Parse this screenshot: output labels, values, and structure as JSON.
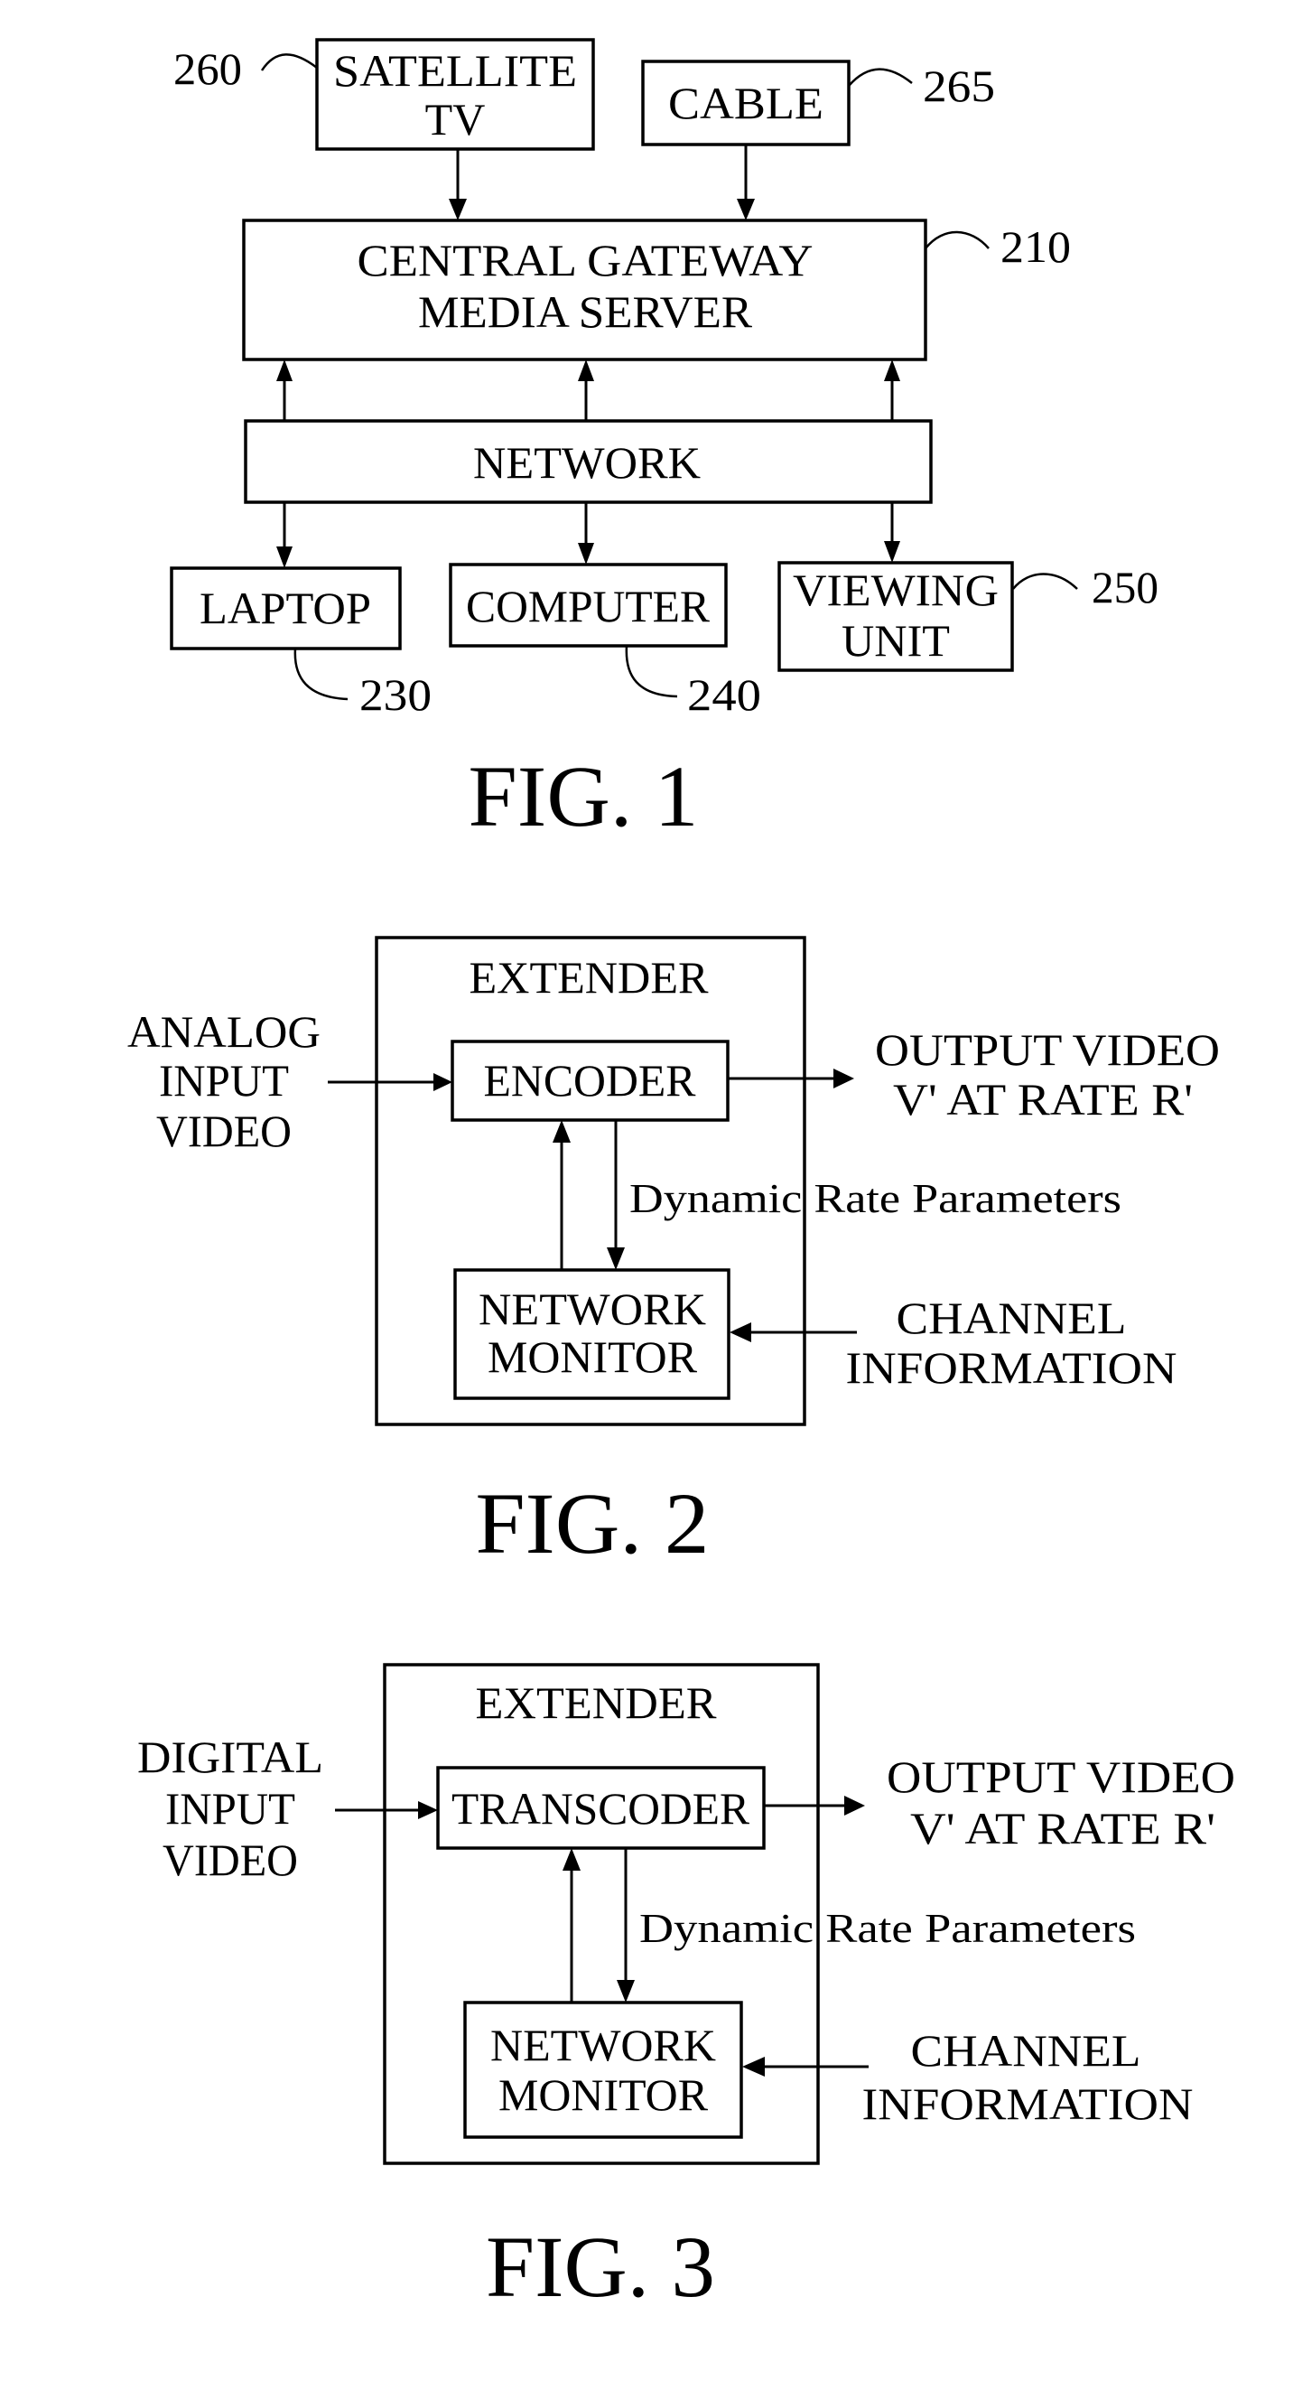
{
  "fig1": {
    "caption": "FIG. 1",
    "satellite": {
      "line1": "SATELLITE",
      "line2": "TV",
      "ref": "260"
    },
    "cable": {
      "label": "CABLE",
      "ref": "265"
    },
    "gateway": {
      "line1": "CENTRAL GATEWAY",
      "line2": "MEDIA SERVER",
      "ref": "210"
    },
    "network": {
      "label": "NETWORK"
    },
    "laptop": {
      "label": "LAPTOP",
      "ref": "230"
    },
    "computer": {
      "label": "COMPUTER",
      "ref": "240"
    },
    "viewing": {
      "line1": "VIEWING",
      "line2": "UNIT",
      "ref": "250"
    }
  },
  "fig2": {
    "caption": "FIG. 2",
    "extender": "EXTENDER",
    "input": [
      "ANALOG",
      "INPUT",
      "VIDEO"
    ],
    "core": "ENCODER",
    "output": [
      "OUTPUT VIDEO",
      "V' AT RATE R'"
    ],
    "feedback": "Dynamic Rate Parameters",
    "monitor": [
      "NETWORK",
      "MONITOR"
    ],
    "channel": [
      "CHANNEL",
      "INFORMATION"
    ]
  },
  "fig3": {
    "caption": "FIG. 3",
    "extender": "EXTENDER",
    "input": [
      "DIGITAL",
      "INPUT",
      "VIDEO"
    ],
    "core": "TRANSCODER",
    "output": [
      "OUTPUT VIDEO",
      "V' AT RATE R'"
    ],
    "feedback": "Dynamic Rate Parameters",
    "monitor": [
      "NETWORK",
      "MONITOR"
    ],
    "channel": [
      "CHANNEL",
      "INFORMATION"
    ]
  }
}
